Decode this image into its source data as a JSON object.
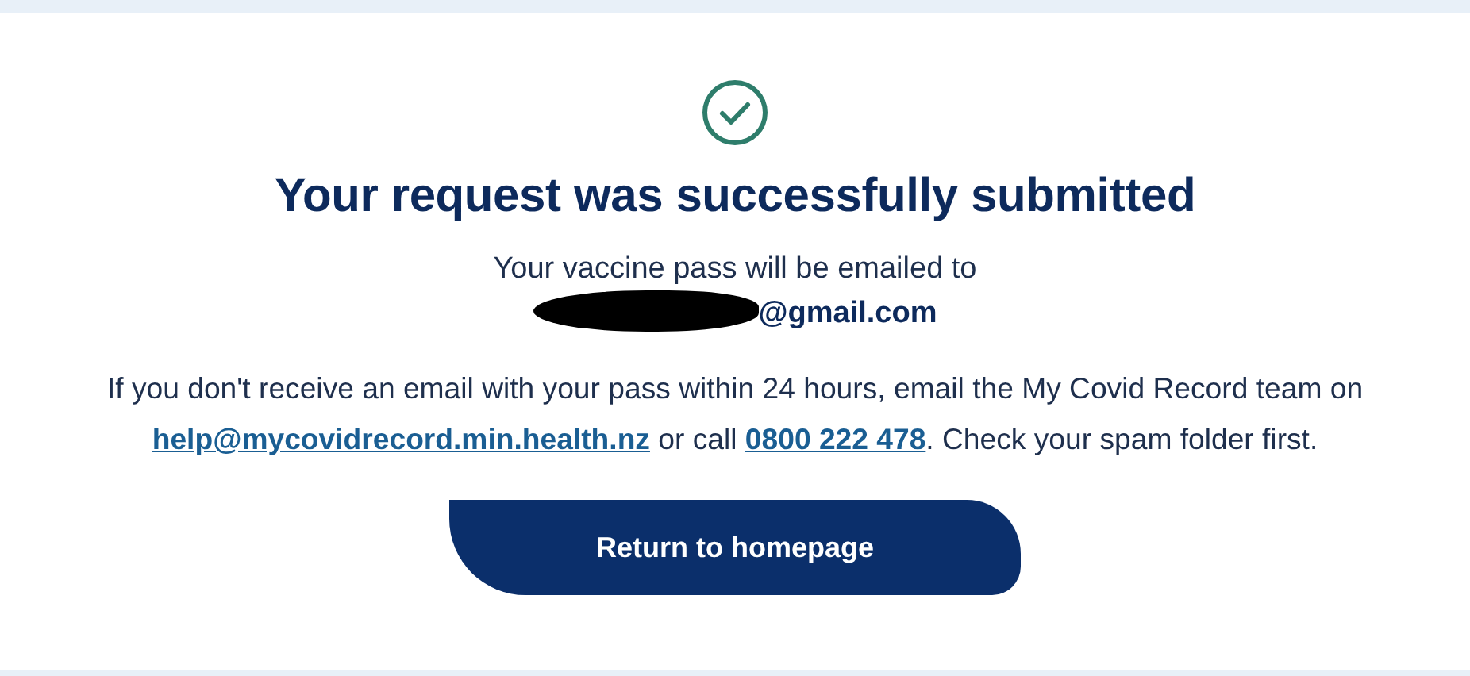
{
  "status_icon": {
    "kind": "success"
  },
  "heading": "Your request was successfully submitted",
  "notice": {
    "text": "Your vaccine pass will be emailed to",
    "email": {
      "redacted": true,
      "visible_text": "@gmail.com"
    }
  },
  "help": {
    "parts": [
      {
        "kind": "text",
        "text": "If you don't receive an email with your pass within 24 hours, email the My Covid Record team on "
      },
      {
        "kind": "link",
        "text": "help@mycovidrecord.min.health.nz"
      },
      {
        "kind": "text",
        "text": " or call "
      },
      {
        "kind": "link",
        "text": "0800 222 478"
      },
      {
        "kind": "text",
        "text": ". Check your spam folder first."
      }
    ]
  },
  "button": {
    "label": "Return to homepage"
  }
}
